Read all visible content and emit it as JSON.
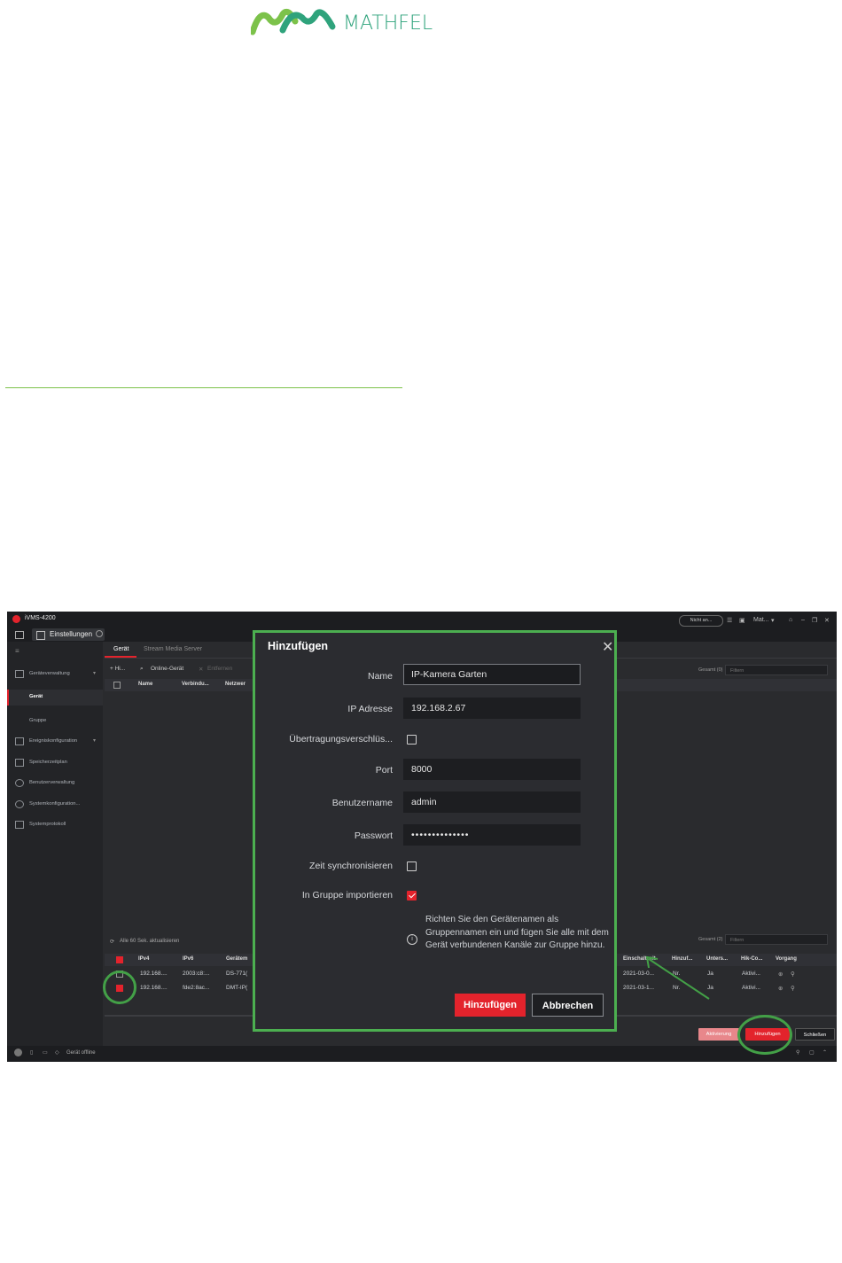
{
  "brand": {
    "name": "MATHFEL",
    "color": "#2fa37c"
  },
  "app": {
    "title": "iVMS-4200",
    "tab_label": "Einstellungen",
    "cloud_status": "Nicht an...",
    "user": "Mat..."
  },
  "sidebar": {
    "items": [
      {
        "label": "Geräteverwaltung",
        "icon": "device-icon",
        "arrow": "▾"
      },
      {
        "label": "Gerät",
        "active": true
      },
      {
        "label": "Gruppe"
      },
      {
        "label": "Ereigniskonfiguration",
        "icon": "event-icon",
        "arrow": "▾"
      },
      {
        "label": "Speicherzeitplan",
        "icon": "storage-icon"
      },
      {
        "label": "Benutzerverwaltung",
        "icon": "user-icon"
      },
      {
        "label": "Systemkonfiguration...",
        "icon": "gear-icon"
      },
      {
        "label": "Systemprotokoll",
        "icon": "log-icon"
      }
    ]
  },
  "main": {
    "tabs": [
      "Gerät",
      "Stream Media Server"
    ],
    "toolbar": {
      "add": "+ Hi...",
      "online": "Online-Gerät",
      "delete": "Entfernen"
    },
    "total_top": "Gesamt (0)",
    "filter_placeholder": "Filtern",
    "top_headers": [
      "Name",
      "Verbindu...",
      "Netzwer"
    ],
    "refresh_label": "Alle 60 Sek. aktualisieren",
    "total_bottom": "Gesamt (2)",
    "bottom_headers_left": [
      "IPv4",
      "IPv6",
      "Gerätem"
    ],
    "bottom_headers_right": [
      "Einschaltzeit",
      "Hinzuf...",
      "Unters...",
      "Hik-Co...",
      "Vorgang"
    ],
    "rows": [
      {
        "ipv4": "192.168....",
        "ipv6": "2003:c8:...",
        "model": "DS-771(",
        "time": "2021-03-0...",
        "added": "Nr.",
        "supported": "Ja",
        "hik": "Aktivi...",
        "checked": false
      },
      {
        "ipv4": "192.168....",
        "ipv6": "fde2:8ac...",
        "model": "DMT-IP(",
        "time": "2021-03-1...",
        "added": "Nr.",
        "supported": "Ja",
        "hik": "Aktivi...",
        "checked": true
      }
    ],
    "buttons": {
      "activate": "Aktivierung",
      "add": "Hinzufügen",
      "close": "Schließen"
    }
  },
  "status": {
    "text": "Gerät offline"
  },
  "dialog": {
    "title": "Hinzufügen",
    "fields": {
      "name_label": "Name",
      "name_value": "IP-Kamera Garten",
      "ip_label": "IP Adresse",
      "ip_value": "192.168.2.67",
      "encryption_label": "Übertragungsverschlüs...",
      "port_label": "Port",
      "port_value": "8000",
      "user_label": "Benutzername",
      "user_value": "admin",
      "password_label": "Passwort",
      "password_value": "••••••••••••••",
      "timesync_label": "Zeit synchronisieren",
      "group_label": "In Gruppe importieren"
    },
    "info": "Richten Sie den Gerätenamen als Gruppennamen ein und fügen Sie alle mit dem Gerät verbundenen Kanäle zur Gruppe hinzu.",
    "add_button": "Hinzufügen",
    "cancel_button": "Abbrechen"
  },
  "colors": {
    "accent_red": "#e3232c",
    "highlight_green": "#43a047",
    "separator_green": "#7cc24a"
  }
}
